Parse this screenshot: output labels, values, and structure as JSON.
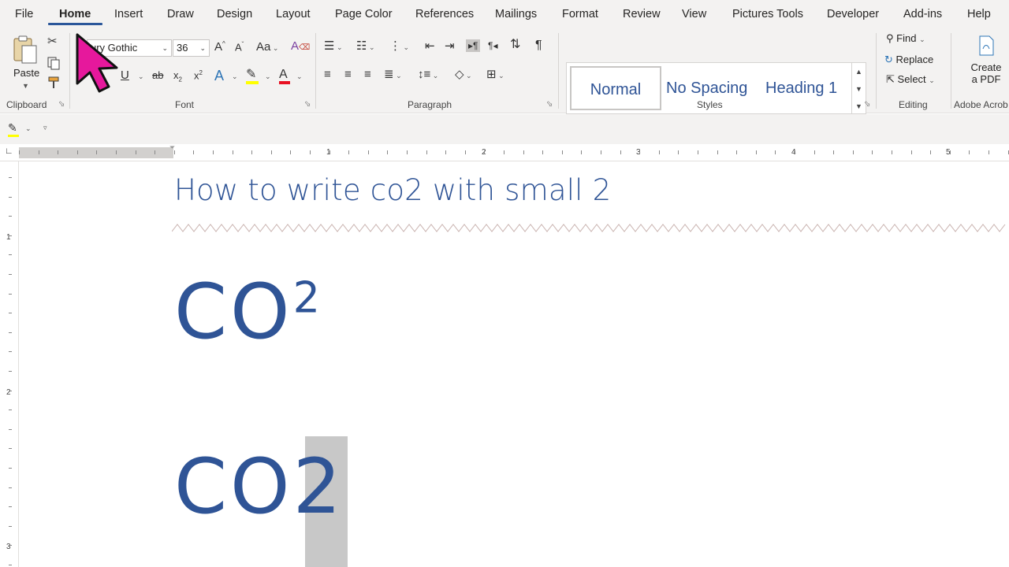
{
  "tabs": [
    "File",
    "Home",
    "Insert",
    "Draw",
    "Design",
    "Layout",
    "Page Color",
    "References",
    "Mailings",
    "Format",
    "Review",
    "View",
    "Pictures Tools",
    "Developer",
    "Add-ins",
    "Help"
  ],
  "active_tab": "Home",
  "clipboard": {
    "paste_label": "Paste",
    "group_label": "Clipboard"
  },
  "font": {
    "family": "ury Gothic",
    "size": "36",
    "group_label": "Font",
    "aa_label": "Aa"
  },
  "paragraph": {
    "group_label": "Paragraph"
  },
  "styles": {
    "items": [
      "Normal",
      "No Spacing",
      "Heading 1"
    ],
    "group_label": "Styles"
  },
  "editing": {
    "find": "Find",
    "replace": "Replace",
    "select": "Select",
    "group_label": "Editing"
  },
  "acrobat": {
    "create_line1": "Create",
    "create_line2": "a PDF",
    "group_label": "Adobe Acrob"
  },
  "ruler": {
    "numbers": [
      "1",
      "2",
      "3",
      "4",
      "5"
    ],
    "vnumbers": [
      "1",
      "2",
      "3"
    ]
  },
  "document": {
    "title": "How to write co2 with small 2",
    "line1_base": "CO",
    "line1_sup": "2",
    "line2_base": "CO",
    "line2_sel": "2"
  },
  "colors": {
    "accent": "#2b579a",
    "heading": "#2f5496",
    "cursor": "#e6189c"
  }
}
